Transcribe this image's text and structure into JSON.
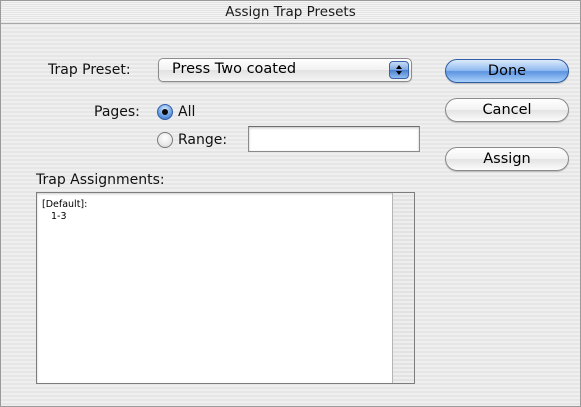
{
  "window": {
    "title": "Assign Trap Presets"
  },
  "trap_preset": {
    "label": "Trap Preset:",
    "value": "Press Two coated"
  },
  "pages": {
    "label": "Pages:",
    "all_label": "All",
    "range_label": "Range:",
    "selected": "All",
    "range_value": ""
  },
  "assignments": {
    "label": "Trap Assignments:",
    "items": [
      "[Default]:",
      "1-3"
    ]
  },
  "buttons": {
    "done": "Done",
    "cancel": "Cancel",
    "assign": "Assign"
  },
  "colors": {
    "accent_blue": "#5b93e0",
    "window_stripe": "#e6e6e6"
  }
}
